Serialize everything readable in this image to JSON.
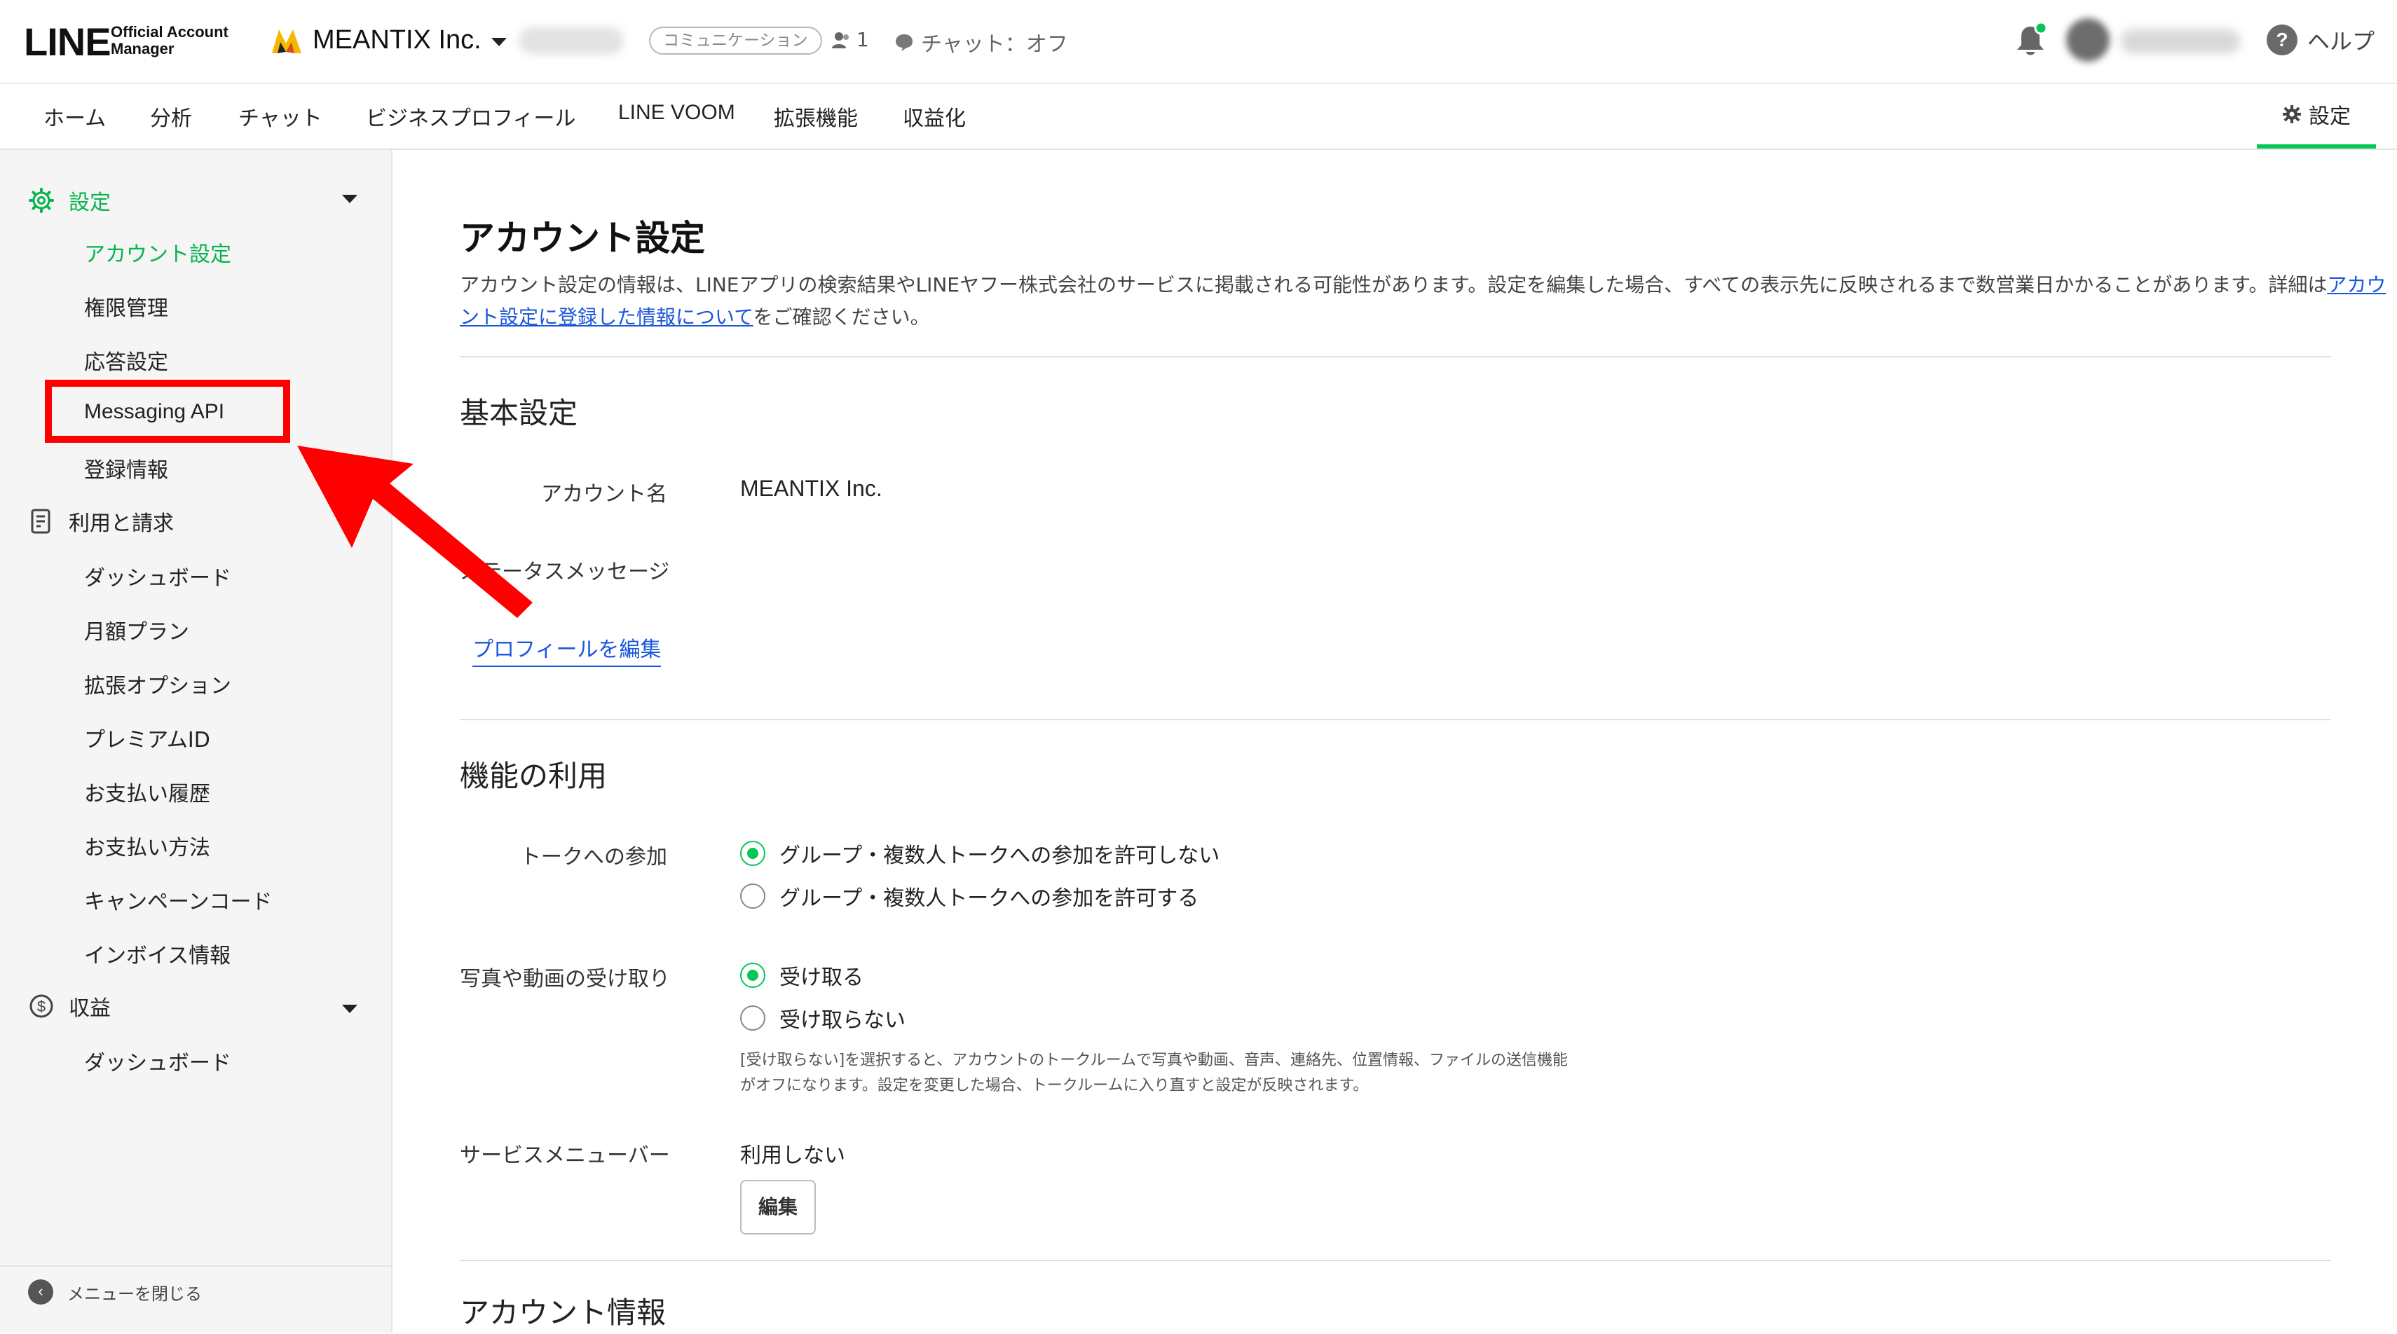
{
  "header": {
    "logo_main": "LINE",
    "logo_sub_line1": "Official Account",
    "logo_sub_line2": "Manager",
    "account_name": "MEANTIX Inc.",
    "plan_badge": "コミュニケーション",
    "member_count": "1",
    "chat_status": "チャット：オフ",
    "help_label": "ヘルプ"
  },
  "nav": {
    "tabs": [
      {
        "label": "ホーム"
      },
      {
        "label": "分析"
      },
      {
        "label": "チャット"
      },
      {
        "label": "ビジネスプロフィール"
      },
      {
        "label": "LINE VOOM"
      },
      {
        "label": "拡張機能"
      },
      {
        "label": "収益化"
      }
    ],
    "settings_tab": "設定"
  },
  "sidebar": {
    "settings_section": "設定",
    "settings_items": [
      {
        "label": "アカウント設定"
      },
      {
        "label": "権限管理"
      },
      {
        "label": "応答設定"
      },
      {
        "label": "Messaging API"
      },
      {
        "label": "登録情報"
      }
    ],
    "billing_section": "利用と請求",
    "billing_items": [
      {
        "label": "ダッシュボード"
      },
      {
        "label": "月額プラン"
      },
      {
        "label": "拡張オプション"
      },
      {
        "label": "プレミアムID"
      },
      {
        "label": "お支払い履歴"
      },
      {
        "label": "お支払い方法"
      },
      {
        "label": "キャンペーンコード"
      },
      {
        "label": "インボイス情報"
      }
    ],
    "revenue_section": "収益",
    "revenue_items": [
      {
        "label": "ダッシュボード"
      }
    ],
    "close_menu": "メニューを閉じる"
  },
  "main": {
    "title": "アカウント設定",
    "description_before": "アカウント設定の情報は、LINEアプリの検索結果やLINEヤフー株式会社のサービスに掲載される可能性があります。設定を編集した場合、すべての表示先に反映されるまで数営業日かかることがあります。詳細は",
    "description_link": "アカウント設定に登録した情報について",
    "description_after": "をご確認ください。",
    "basic": {
      "heading": "基本設定",
      "account_name_label": "アカウント名",
      "account_name_value": "MEANTIX Inc.",
      "status_message_label": "ステータスメッセージ",
      "edit_profile_link": "プロフィールを編集"
    },
    "features": {
      "heading": "機能の利用",
      "talk_label": "トークへの参加",
      "talk_option_deny": "グループ・複数人トークへの参加を許可しない",
      "talk_option_allow": "グループ・複数人トークへの参加を許可する",
      "media_label": "写真や動画の受け取り",
      "media_option_accept": "受け取る",
      "media_option_reject": "受け取らない",
      "media_note": "[受け取らない]を選択すると、アカウントのトークルームで写真や動画、音声、連絡先、位置情報、ファイルの送信機能がオフになります。設定を変更した場合、トークルームに入り直すと設定が反映されます。",
      "service_menu_label": "サービスメニューバー",
      "service_menu_value": "利用しない",
      "edit_button": "編集"
    },
    "account_info_heading": "アカウント情報"
  },
  "colors": {
    "brand_green": "#06c755",
    "highlight_red": "#ff0000",
    "link_blue": "#1a56db"
  }
}
